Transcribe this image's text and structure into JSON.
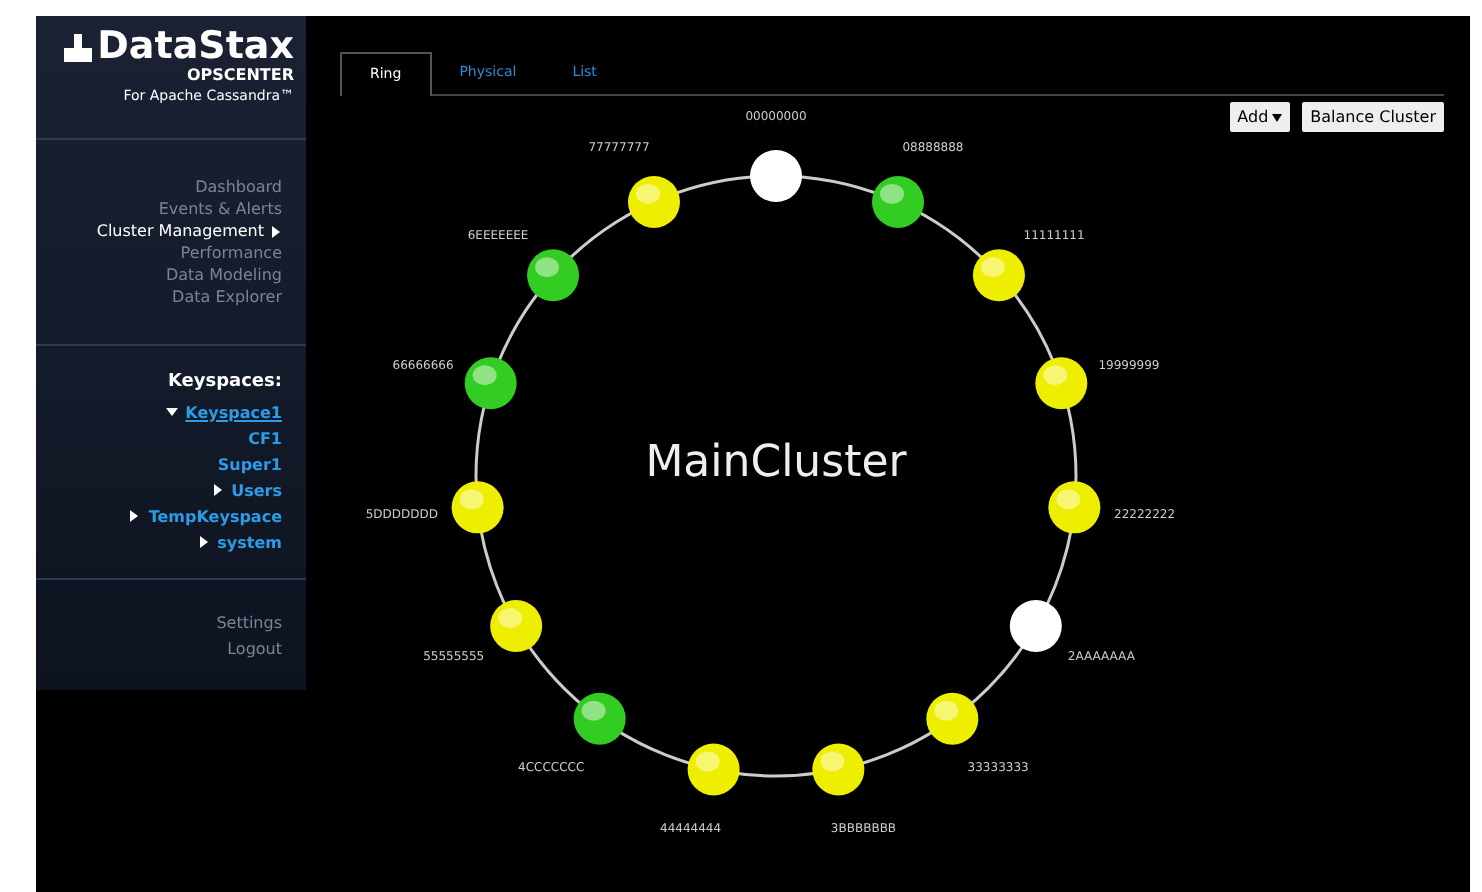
{
  "logo": {
    "name": "DataStax",
    "product": "OPSCENTER",
    "tagline": "For Apache Cassandra™"
  },
  "nav": [
    {
      "label": "Dashboard",
      "selected": false
    },
    {
      "label": "Events & Alerts",
      "selected": false
    },
    {
      "label": "Cluster Management",
      "selected": true
    },
    {
      "label": "Performance",
      "selected": false
    },
    {
      "label": "Data Modeling",
      "selected": false
    },
    {
      "label": "Data Explorer",
      "selected": false
    }
  ],
  "keyspaces": {
    "heading": "Keyspaces:",
    "items": [
      {
        "label": "Keyspace1",
        "expanded": true,
        "selected": true,
        "children": [
          {
            "label": "CF1",
            "selected": false
          },
          {
            "label": "Super1",
            "selected": false
          },
          {
            "label": "Users",
            "expanded": false,
            "selected": false
          }
        ]
      },
      {
        "label": "TempKeyspace",
        "expanded": false,
        "selected": false
      },
      {
        "label": "system",
        "expanded": false,
        "selected": false
      }
    ]
  },
  "footer_nav": [
    "Settings",
    "Logout"
  ],
  "tabs": [
    {
      "label": "Ring",
      "selected": true
    },
    {
      "label": "Physical",
      "selected": false
    },
    {
      "label": "List",
      "selected": false
    }
  ],
  "buttons": [
    {
      "label": "Add",
      "kind": "dropdown"
    },
    {
      "label": "Balance Cluster",
      "kind": "plain"
    }
  ],
  "ring": {
    "cluster": "MainCluster",
    "nodes": [
      {
        "token": "00000000",
        "color": "#ffffff"
      },
      {
        "token": "08888888",
        "color": "#33cc22"
      },
      {
        "token": "11111111",
        "color": "#eeee00"
      },
      {
        "token": "19999999",
        "color": "#eeee00"
      },
      {
        "token": "22222222",
        "color": "#eeee00"
      },
      {
        "token": "2AAAAAAA",
        "color": "#ffffff"
      },
      {
        "token": "33333333",
        "color": "#eeee00"
      },
      {
        "token": "3BBBBBBB",
        "color": "#eeee00"
      },
      {
        "token": "44444444",
        "color": "#eeee00"
      },
      {
        "token": "4CCCCCCC",
        "color": "#33cc22"
      },
      {
        "token": "55555555",
        "color": "#eeee00"
      },
      {
        "token": "5DDDDDDD",
        "color": "#eeee00"
      },
      {
        "token": "66666666",
        "color": "#33cc22"
      },
      {
        "token": "6EEEEEEE",
        "color": "#33cc22"
      },
      {
        "token": "77777777",
        "color": "#eeee00"
      }
    ]
  }
}
